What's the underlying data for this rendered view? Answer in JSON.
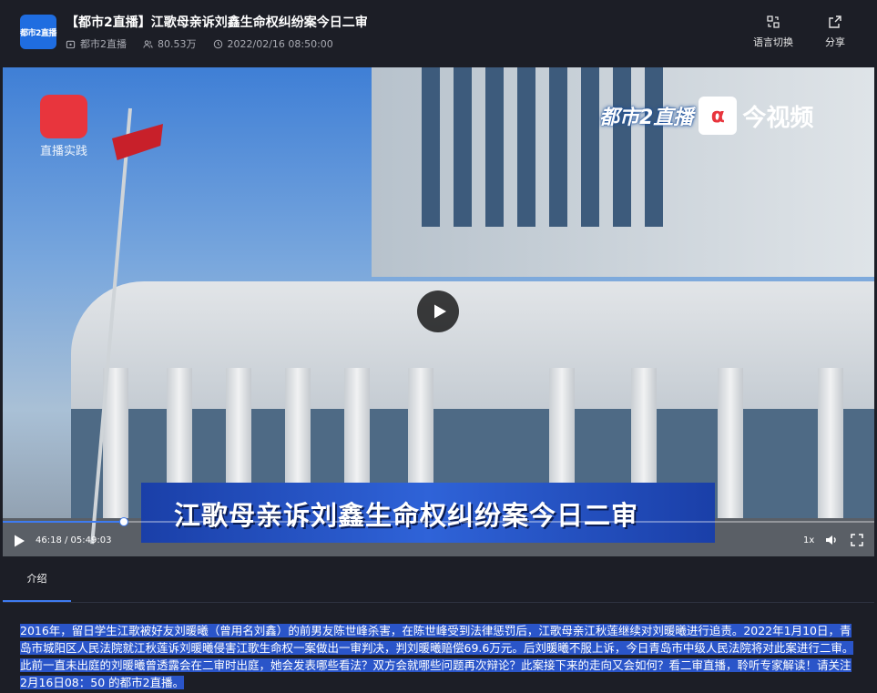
{
  "header": {
    "logo_text": "都市2直播",
    "title": "【都市2直播】江歌母亲诉刘鑫生命权纠纷案今日二审",
    "channel": "都市2直播",
    "views": "80.53万",
    "datetime": "2022/02/16 08:50:00",
    "language_label": "语言切换",
    "share_label": "分享"
  },
  "video": {
    "watermark_left": "直播实践",
    "watermark_badge": "都市2直播",
    "watermark_brand": "今视频",
    "caption": "江歌母亲诉刘鑫生命权纠纷案今日二审",
    "current_time": "46:18",
    "duration": "05:49:03",
    "time_display": "46:18 / 05:49:03",
    "progress": 0.138,
    "speed": "1x"
  },
  "tabs": [
    {
      "label": "介绍",
      "active": true
    }
  ],
  "description": "2016年，留日学生江歌被好友刘暖曦（曾用名刘鑫）的前男友陈世峰杀害，在陈世峰受到法律惩罚后，江歌母亲江秋莲继续对刘暖曦进行追责。2022年1月10日，青岛市城阳区人民法院就江秋莲诉刘暖曦侵害江歌生命权一案做出一审判决，判刘暖曦赔偿69.6万元。后刘暖曦不服上诉，今日青岛市中级人民法院将对此案进行二审。此前一直未出庭的刘暖曦曾透露会在二审时出庭，她会发表哪些看法？双方会就哪些问题再次辩论？此案接下来的走向又会如何？看二审直播，聆听专家解读！请关注2月16日08：50 的都市2直播。",
  "colors": {
    "accent": "#3e7bf0",
    "background": "#1c1e26",
    "selection": "#2a55c9"
  }
}
